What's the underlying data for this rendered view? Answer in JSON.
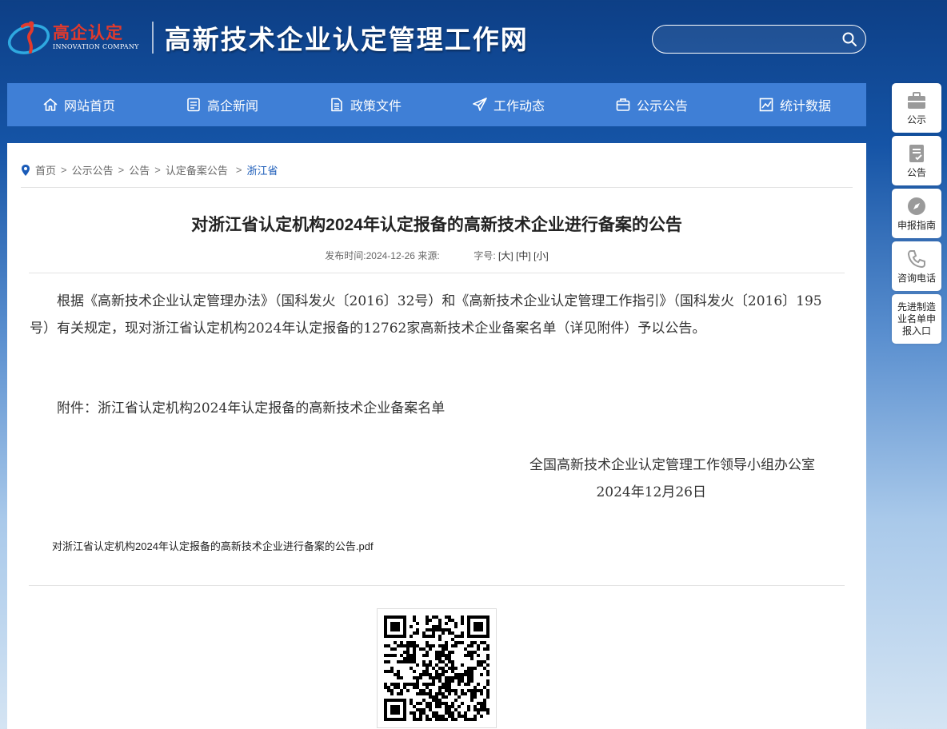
{
  "header": {
    "logo_cn": "高企认定",
    "logo_en": "INNOVATION COMPANY",
    "site_title": "高新技术企业认定管理工作网",
    "search_placeholder": ""
  },
  "nav": {
    "items": [
      {
        "label": "网站首页",
        "icon": "home-icon"
      },
      {
        "label": "高企新闻",
        "icon": "news-icon"
      },
      {
        "label": "政策文件",
        "icon": "document-icon"
      },
      {
        "label": "工作动态",
        "icon": "send-icon"
      },
      {
        "label": "公示公告",
        "icon": "briefcase-icon"
      },
      {
        "label": "统计数据",
        "icon": "chart-icon"
      }
    ]
  },
  "breadcrumb": {
    "items": [
      "首页",
      "公示公告",
      "公告",
      "认定备案公告",
      "浙江省"
    ],
    "separator": ">"
  },
  "article": {
    "title": "对浙江省认定机构2024年认定报备的高新技术企业进行备案的公告",
    "meta": {
      "publish_label": "发布时间:",
      "publish_date": "2024-12-26",
      "source_label": "来源:",
      "font_label": "字号:",
      "font_large": "[大]",
      "font_medium": "[中]",
      "font_small": "[小]"
    },
    "body": "根据《高新技术企业认定管理办法》（国科发火〔2016〕32号）和《高新技术企业认定管理工作指引》（国科发火〔2016〕195号）有关规定，现对浙江省认定机构2024年认定报备的12762家高新技术企业备案名单（详见附件）予以公告。",
    "attachment_line": "附件：浙江省认定机构2024年认定报备的高新技术企业备案名单",
    "signature_org": "全国高新技术企业认定管理工作领导小组办公室",
    "signature_date": "2024年12月26日",
    "pdf_link": "对浙江省认定机构2024年认定报备的高新技术企业进行备案的公告.pdf"
  },
  "sidebar": {
    "items": [
      {
        "label": "公示",
        "icon": "briefcase-icon"
      },
      {
        "label": "公告",
        "icon": "notice-icon"
      },
      {
        "label": "申报指南",
        "icon": "compass-icon"
      },
      {
        "label": "咨询电话",
        "icon": "phone-icon"
      },
      {
        "label": "先进制造业名单申报入口",
        "icon": ""
      }
    ]
  },
  "colors": {
    "nav_bg": "#3f7fd6",
    "header_bg": "#0d3f86",
    "link_active": "#1a5bb8",
    "logo_red": "#e23a2c"
  }
}
